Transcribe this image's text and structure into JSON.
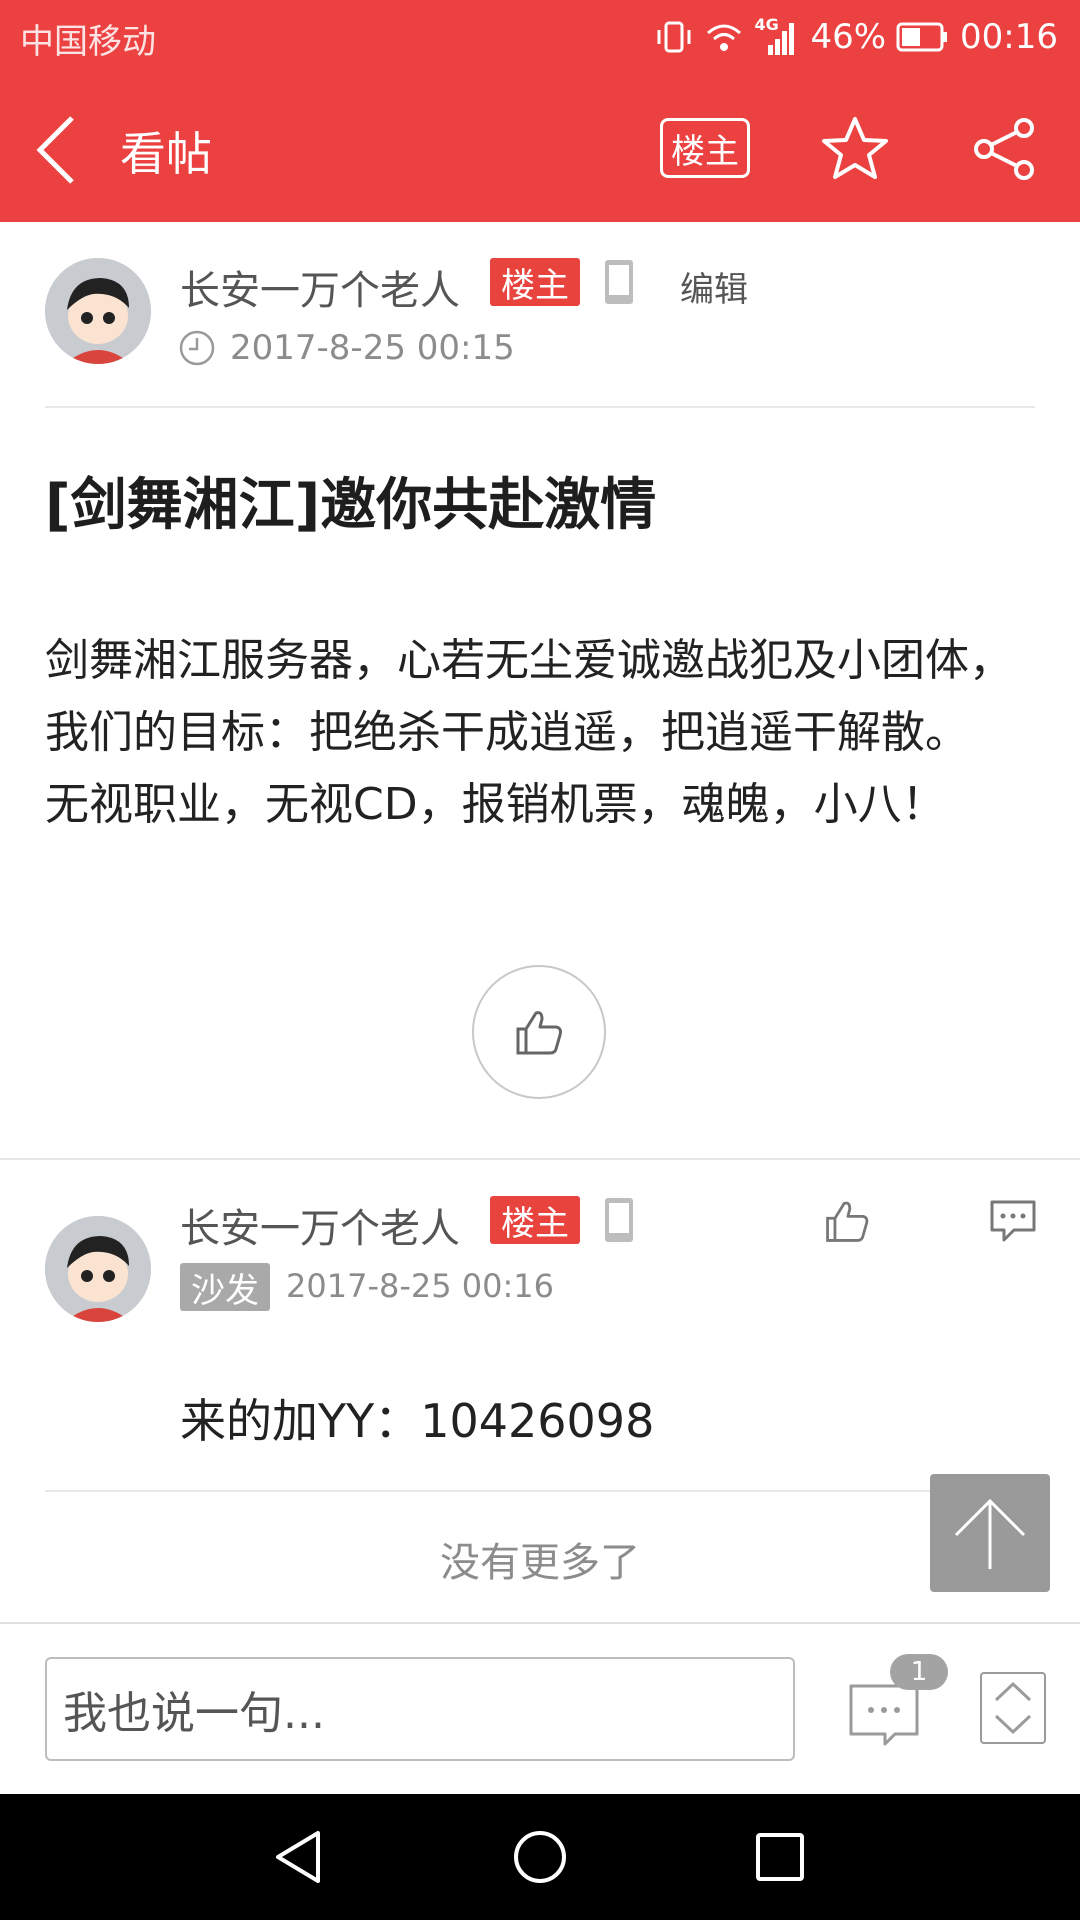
{
  "status_bar": {
    "carrier": "中国移动",
    "network": "4G",
    "battery": "46%",
    "time": "00:16"
  },
  "header": {
    "title": "看帖",
    "op_only_label": "楼主",
    "icons": [
      "back-icon",
      "star-icon",
      "share-icon"
    ],
    "background_color": "#ec4141"
  },
  "post": {
    "author": "长安一万个老人",
    "author_badge": "楼主",
    "edit_label": "编辑",
    "timestamp": "2017-8-25 00:15",
    "title": "[剑舞湘江]邀你共赴激情",
    "body_lines": [
      "剑舞湘江服务器，心若无尘爱诚邀战犯及小团体，我们的目标：把绝杀干成逍遥，把逍遥干解散。",
      "无视职业，无视CD，报销机票，魂魄，小八！"
    ]
  },
  "reply": {
    "author": "长安一万个老人",
    "author_badge": "楼主",
    "floor_badge": "沙发",
    "timestamp": "2017-8-25 00:16",
    "text": "来的加YY：10426098"
  },
  "footer_note": "没有更多了",
  "bottom_bar": {
    "input_placeholder": "我也说一句...",
    "comment_count": "1"
  },
  "colors": {
    "accent": "#ec4141",
    "badge_red": "#e8433d",
    "muted_text": "#8c8c8c"
  }
}
